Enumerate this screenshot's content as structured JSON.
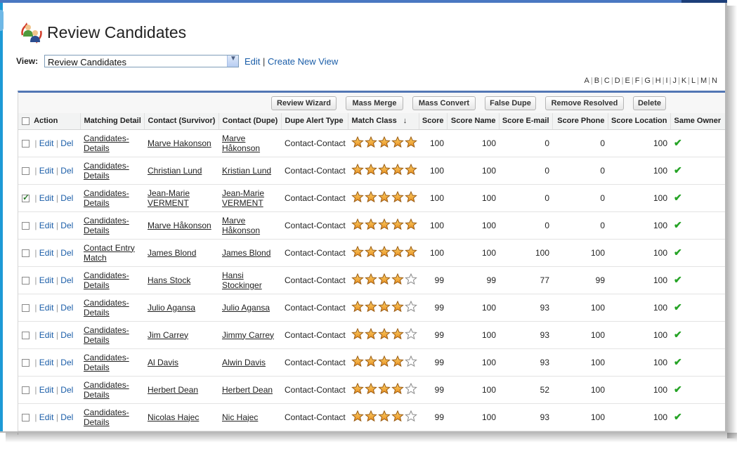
{
  "page": {
    "title": "Review Candidates",
    "icon": "users-sync-icon"
  },
  "view": {
    "label": "View:",
    "selected": "Review Candidates",
    "edit_link": "Edit",
    "create_link": "Create New View"
  },
  "alphabet": [
    "A",
    "B",
    "C",
    "D",
    "E",
    "F",
    "G",
    "H",
    "I",
    "J",
    "K",
    "L",
    "M",
    "N"
  ],
  "toolbar": {
    "buttons": [
      "Review Wizard",
      "Mass Merge",
      "Mass Convert",
      "False Dupe",
      "Remove Resolved",
      "Delete"
    ]
  },
  "table": {
    "columns": [
      "Action",
      "Matching Detail",
      "Contact (Survivor)",
      "Contact (Dupe)",
      "Dupe Alert Type",
      "Match Class",
      "Score",
      "Score Name",
      "Score E-mail",
      "Score Phone",
      "Score Location",
      "Same Owner"
    ],
    "sort_indicator": "↓",
    "action_links": {
      "edit": "Edit",
      "del": "Del"
    },
    "rows": [
      {
        "checked": false,
        "detail": "Candidates-Details",
        "survivor": "Marve Hakonson",
        "dupe": "Marve Håkonson",
        "type": "Contact-Contact",
        "stars": 5,
        "score": "100",
        "score_name": "100",
        "score_email": "0",
        "score_phone": "0",
        "score_location": "100",
        "same_owner": "✔"
      },
      {
        "checked": false,
        "detail": "Candidates-Details",
        "survivor": "Christian Lund",
        "dupe": "Kristian Lund",
        "type": "Contact-Contact",
        "stars": 5,
        "score": "100",
        "score_name": "100",
        "score_email": "0",
        "score_phone": "0",
        "score_location": "100",
        "same_owner": "✔"
      },
      {
        "checked": true,
        "detail": "Candidates-Details",
        "survivor": "Jean-Marie VERMENT",
        "dupe": "Jean-Marie VERMENT",
        "type": "Contact-Contact",
        "stars": 5,
        "score": "100",
        "score_name": "100",
        "score_email": "0",
        "score_phone": "0",
        "score_location": "100",
        "same_owner": "✔"
      },
      {
        "checked": false,
        "detail": "Candidates-Details",
        "survivor": "Marve Håkonson",
        "dupe": "Marve Håkonson",
        "type": "Contact-Contact",
        "stars": 5,
        "score": "100",
        "score_name": "100",
        "score_email": "0",
        "score_phone": "0",
        "score_location": "100",
        "same_owner": "✔"
      },
      {
        "checked": false,
        "detail": "Contact Entry Match",
        "survivor": "James Blond",
        "dupe": "James Blond",
        "type": "Contact-Contact",
        "stars": 5,
        "score": "100",
        "score_name": "100",
        "score_email": "100",
        "score_phone": "100",
        "score_location": "100",
        "same_owner": "✔"
      },
      {
        "checked": false,
        "detail": "Candidates-Details",
        "survivor": "Hans Stock",
        "dupe": "Hansi Stockinger",
        "type": "Contact-Contact",
        "stars": 4,
        "score": "99",
        "score_name": "99",
        "score_email": "77",
        "score_phone": "99",
        "score_location": "100",
        "same_owner": "✔"
      },
      {
        "checked": false,
        "detail": "Candidates-Details",
        "survivor": "Julio Agansa",
        "dupe": "Julio Agansa",
        "type": "Contact-Contact",
        "stars": 4,
        "score": "99",
        "score_name": "100",
        "score_email": "93",
        "score_phone": "100",
        "score_location": "100",
        "same_owner": "✔"
      },
      {
        "checked": false,
        "detail": "Candidates-Details",
        "survivor": "Jim Carrey",
        "dupe": "Jimmy Carrey",
        "type": "Contact-Contact",
        "stars": 4,
        "score": "99",
        "score_name": "100",
        "score_email": "93",
        "score_phone": "100",
        "score_location": "100",
        "same_owner": "✔"
      },
      {
        "checked": false,
        "detail": "Candidates-Details",
        "survivor": "Al Davis",
        "dupe": "Alwin Davis",
        "type": "Contact-Contact",
        "stars": 4,
        "score": "99",
        "score_name": "100",
        "score_email": "93",
        "score_phone": "100",
        "score_location": "100",
        "same_owner": "✔"
      },
      {
        "checked": false,
        "detail": "Candidates-Details",
        "survivor": "Herbert Dean",
        "dupe": "Herbert Dean",
        "type": "Contact-Contact",
        "stars": 4,
        "score": "99",
        "score_name": "100",
        "score_email": "52",
        "score_phone": "100",
        "score_location": "100",
        "same_owner": "✔"
      },
      {
        "checked": false,
        "detail": "Candidates-Details",
        "survivor": "Nicolas Hajec",
        "dupe": "Nic Hajec",
        "type": "Contact-Contact",
        "stars": 4,
        "score": "99",
        "score_name": "100",
        "score_email": "93",
        "score_phone": "100",
        "score_location": "100",
        "same_owner": "✔"
      }
    ]
  },
  "colors": {
    "header_blue": "#5276b4",
    "link_blue": "#1a5da8",
    "star_gold": "#f2a33a",
    "check_green": "#25a325"
  }
}
